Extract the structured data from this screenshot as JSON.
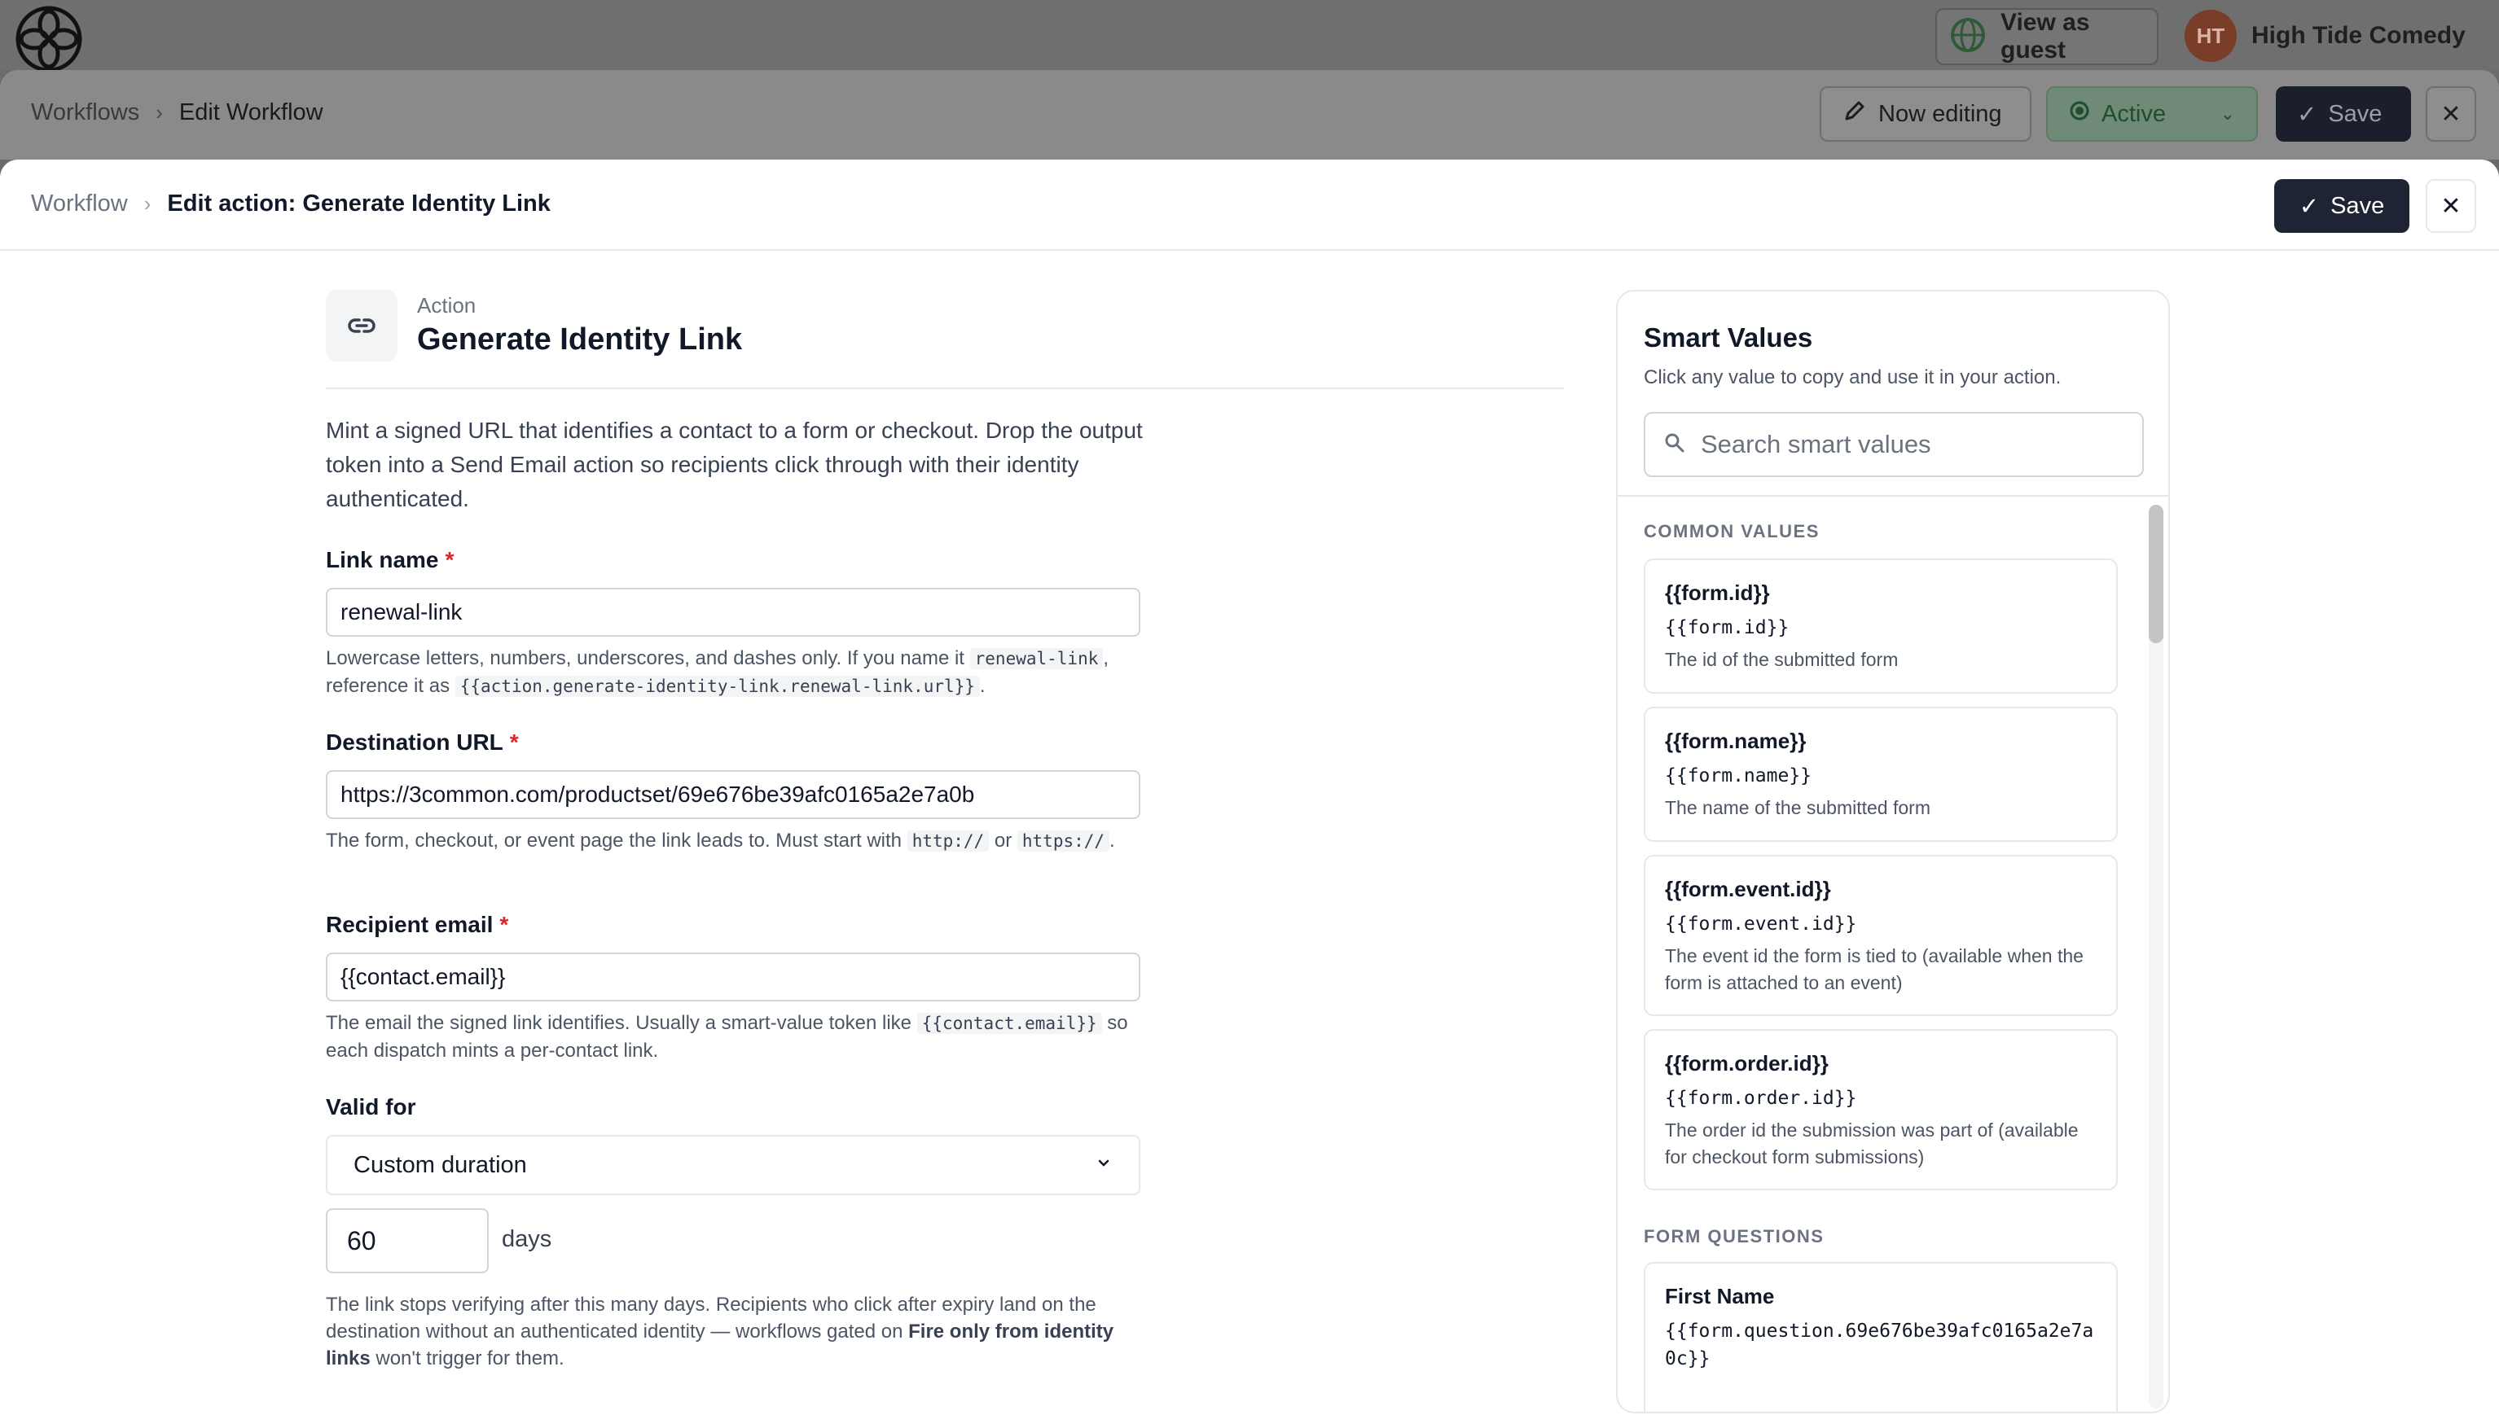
{
  "appbar": {
    "view_as_guest": "View as guest",
    "org_name": "High Tide Comedy",
    "avatar_initials": "HT"
  },
  "workflow_bar": {
    "breadcrumb_root": "Workflows",
    "breadcrumb_current": "Edit Workflow",
    "now_editing": "Now editing",
    "status": "Active",
    "save": "Save"
  },
  "panel": {
    "breadcrumb_root": "Workflow",
    "breadcrumb_current": "Edit action: Generate Identity Link",
    "save": "Save"
  },
  "action": {
    "kicker": "Action",
    "title": "Generate Identity Link",
    "description": "Mint a signed URL that identifies a contact to a form or checkout. Drop the output token into a Send Email action so recipients click through with their identity authenticated."
  },
  "fields": {
    "link_name": {
      "label": "Link name",
      "required_mark": "*",
      "value": "renewal-link",
      "help_pre": "Lowercase letters, numbers, underscores, and dashes only. If you name it",
      "help_code1": "renewal-link",
      "help_mid": ", reference it as",
      "help_code2": "{{action.generate-identity-link.renewal-link.url}}",
      "help_post": "."
    },
    "destination_url": {
      "label": "Destination URL",
      "required_mark": "*",
      "value": "https://3common.com/productset/69e676be39afc0165a2e7a0b",
      "help_pre": "The form, checkout, or event page the link leads to. Must start with",
      "help_code1": "http://",
      "help_mid": "or",
      "help_code2": "https://",
      "help_post": "."
    },
    "recipient_email": {
      "label": "Recipient email",
      "required_mark": "*",
      "value": "{{contact.email}}",
      "help_pre": "The email the signed link identifies. Usually a smart-value token like",
      "help_code1": "{{contact.email}}",
      "help_post": "so each dispatch mints a per-contact link."
    },
    "valid_for": {
      "label": "Valid for",
      "selected": "Custom duration",
      "days_value": "60",
      "days_unit": "days",
      "help_pre": "The link stops verifying after this many days. Recipients who click after expiry land on the destination without an authenticated identity — workflows gated on",
      "help_bold": "Fire only from identity links",
      "help_post": "won't trigger for them."
    }
  },
  "smart_values": {
    "title": "Smart Values",
    "subtitle": "Click any value to copy and use it in your action.",
    "search_placeholder": "Search smart values",
    "common_heading": "COMMON VALUES",
    "common": [
      {
        "title": "{{form.id}}",
        "token": "{{form.id}}",
        "desc": "The id of the submitted form"
      },
      {
        "title": "{{form.name}}",
        "token": "{{form.name}}",
        "desc": "The name of the submitted form"
      },
      {
        "title": "{{form.event.id}}",
        "token": "{{form.event.id}}",
        "desc": "The event id the form is tied to (available when the form is attached to an event)"
      },
      {
        "title": "{{form.order.id}}",
        "token": "{{form.order.id}}",
        "desc": "The order id the submission was part of (available for checkout form submissions)"
      }
    ],
    "questions_heading": "FORM QUESTIONS",
    "questions": [
      {
        "title": "First Name",
        "token": "{{form.question.69e676be39afc0165a2e7a0c}}"
      }
    ]
  },
  "colors": {
    "primary_button": "#1e2433",
    "required": "#dc2626",
    "active_status": "#1f4d2e"
  }
}
